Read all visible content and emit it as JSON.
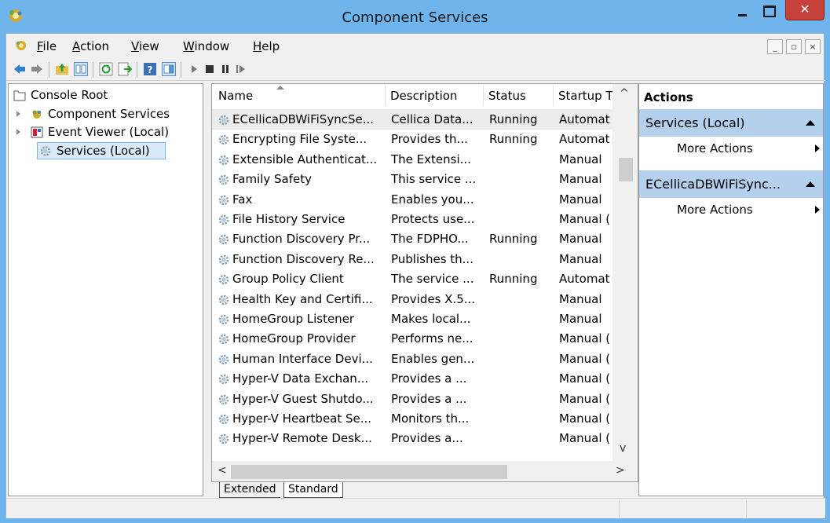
{
  "window": {
    "title": "Component Services",
    "close_glyph": "✕"
  },
  "menu": {
    "items": [
      {
        "key": "F",
        "rest": "ile"
      },
      {
        "key": "A",
        "rest": "ction"
      },
      {
        "key": "V",
        "rest": "iew"
      },
      {
        "key": "W",
        "rest": "indow"
      },
      {
        "key": "H",
        "rest": "elp"
      }
    ]
  },
  "tree": {
    "items": [
      {
        "label": "Console Root",
        "icon": "folder-icon"
      },
      {
        "label": "Component Services",
        "icon": "component-services-icon"
      },
      {
        "label": "Event Viewer (Local)",
        "icon": "event-viewer-icon"
      },
      {
        "label": "Services (Local)",
        "icon": "gear-icon"
      }
    ]
  },
  "list": {
    "columns": [
      "Name",
      "Description",
      "Status",
      "Startup T"
    ],
    "rows": [
      {
        "name": "ECellicaDBWiFiSyncSe...",
        "description": "Cellica Data...",
        "status": "Running",
        "startup": "Automat"
      },
      {
        "name": "Encrypting File Syste...",
        "description": "Provides th...",
        "status": "Running",
        "startup": "Automat"
      },
      {
        "name": "Extensible Authenticat...",
        "description": "The Extensi...",
        "status": "",
        "startup": "Manual"
      },
      {
        "name": "Family Safety",
        "description": "This service ...",
        "status": "",
        "startup": "Manual"
      },
      {
        "name": "Fax",
        "description": "Enables you...",
        "status": "",
        "startup": "Manual"
      },
      {
        "name": "File History Service",
        "description": "Protects use...",
        "status": "",
        "startup": "Manual ("
      },
      {
        "name": "Function Discovery Pr...",
        "description": "The FDPHO...",
        "status": "Running",
        "startup": "Manual"
      },
      {
        "name": "Function Discovery Re...",
        "description": "Publishes th...",
        "status": "",
        "startup": "Manual"
      },
      {
        "name": "Group Policy Client",
        "description": "The service ...",
        "status": "Running",
        "startup": "Automat"
      },
      {
        "name": "Health Key and Certifi...",
        "description": "Provides X.5...",
        "status": "",
        "startup": "Manual"
      },
      {
        "name": "HomeGroup Listener",
        "description": "Makes local...",
        "status": "",
        "startup": "Manual"
      },
      {
        "name": "HomeGroup Provider",
        "description": "Performs ne...",
        "status": "",
        "startup": "Manual ("
      },
      {
        "name": "Human Interface Devi...",
        "description": "Enables gen...",
        "status": "",
        "startup": "Manual ("
      },
      {
        "name": "Hyper-V Data Exchan...",
        "description": "Provides a ...",
        "status": "",
        "startup": "Manual ("
      },
      {
        "name": "Hyper-V Guest Shutdo...",
        "description": "Provides a ...",
        "status": "",
        "startup": "Manual ("
      },
      {
        "name": "Hyper-V Heartbeat Se...",
        "description": "Monitors th...",
        "status": "",
        "startup": "Manual ("
      },
      {
        "name": "Hyper-V Remote Desk...",
        "description": "Provides a...",
        "status": "",
        "startup": "Manual ("
      }
    ]
  },
  "tabs": [
    "Extended",
    "Standard"
  ],
  "actions": {
    "header": "Actions",
    "sections": [
      {
        "title": "Services (Local)",
        "item": "More Actions"
      },
      {
        "title": "ECellicaDBWiFiSync...",
        "item": "More Actions"
      }
    ]
  },
  "colors": {
    "frame": "#6fb5ec",
    "close_button": "#c7413b",
    "action_section": "#b4d0ed",
    "tree_selection": "#d9ebfb"
  }
}
